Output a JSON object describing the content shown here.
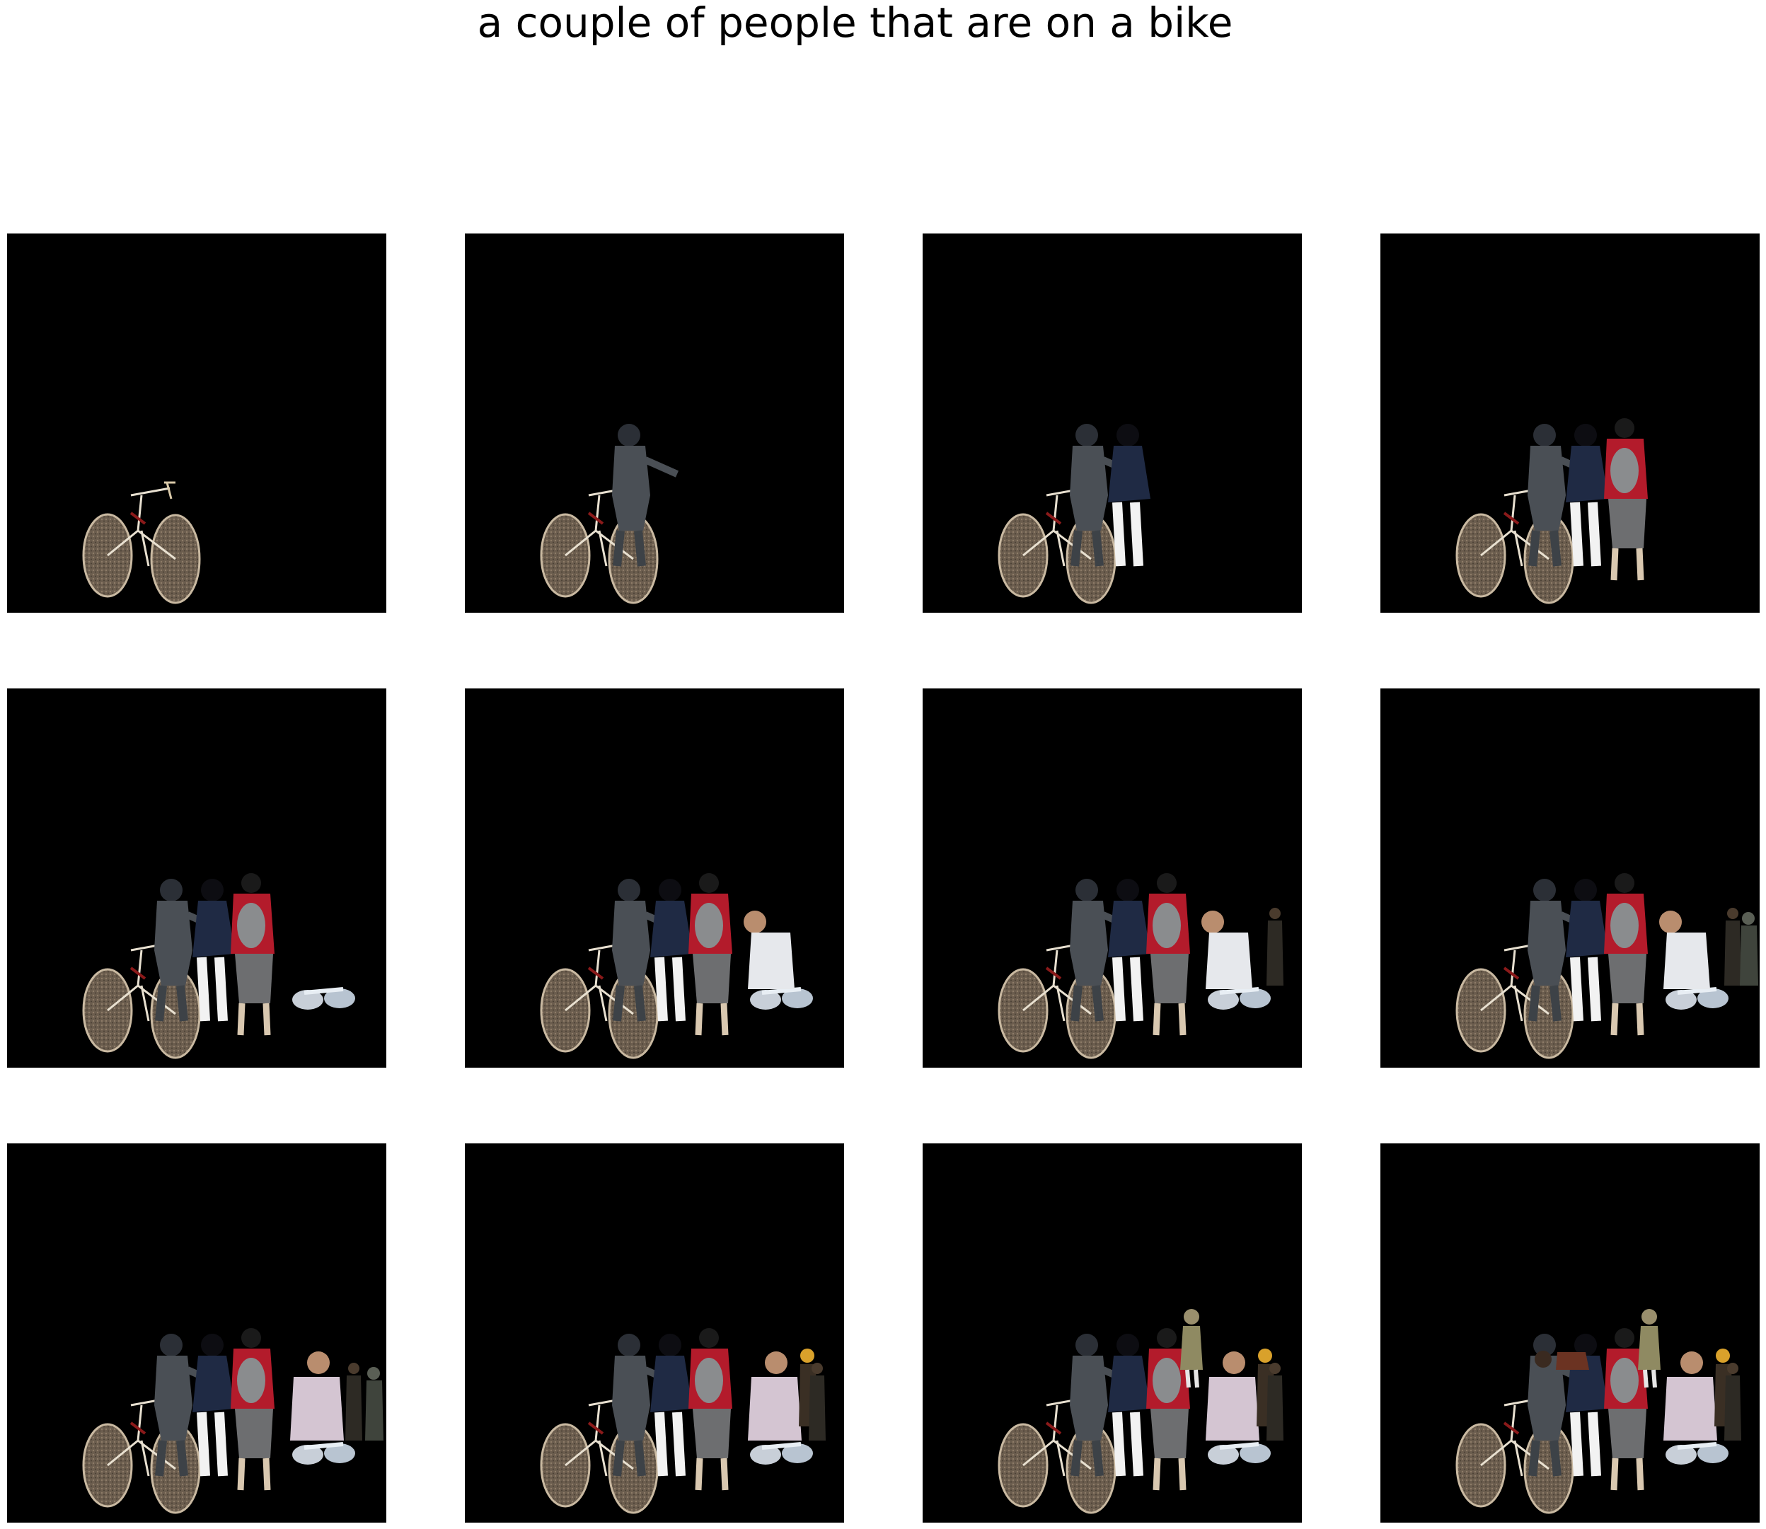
{
  "figure": {
    "title": "a couple of people that are on a bike"
  },
  "panels": [
    {
      "step": 1,
      "objects": [
        "bicycle"
      ]
    },
    {
      "step": 2,
      "objects": [
        "bicycle",
        "cyclist-helmet"
      ]
    },
    {
      "step": 3,
      "objects": [
        "bicycle",
        "cyclist-helmet",
        "person-navy"
      ]
    },
    {
      "step": 4,
      "objects": [
        "bicycle",
        "cyclist-helmet",
        "person-navy",
        "person-red-backpack"
      ]
    },
    {
      "step": 5,
      "objects": [
        "bicycle",
        "cyclist-helmet",
        "person-navy",
        "person-red-backpack",
        "bike-white"
      ]
    },
    {
      "step": 6,
      "objects": [
        "bicycle",
        "cyclist-helmet",
        "person-navy",
        "person-red-backpack",
        "bike-white",
        "man-white-shirt"
      ]
    },
    {
      "step": 7,
      "objects": [
        "bicycle",
        "cyclist-helmet",
        "person-navy",
        "person-red-backpack",
        "bike-white",
        "man-white-shirt",
        "dark-figure"
      ]
    },
    {
      "step": 8,
      "objects": [
        "bicycle",
        "cyclist-helmet",
        "person-navy",
        "person-red-backpack",
        "bike-white",
        "man-white-shirt",
        "dark-figure",
        "dark-figure-2"
      ]
    },
    {
      "step": 9,
      "objects": [
        "bicycle",
        "cyclist-helmet",
        "person-navy",
        "person-red-backpack",
        "bike-white",
        "man-pink-shirt",
        "dark-figures"
      ]
    },
    {
      "step": 10,
      "objects": [
        "bicycle",
        "cyclist-helmet",
        "person-navy",
        "person-red-backpack",
        "bike-white",
        "man-pink-shirt",
        "small-person-yellow",
        "dark-figure"
      ]
    },
    {
      "step": 11,
      "objects": [
        "bicycle",
        "cyclist-helmet",
        "person-navy",
        "person-red-backpack",
        "bike-white",
        "man-pink-shirt",
        "small-person-yellow",
        "small-person-top",
        "dark-figure"
      ]
    },
    {
      "step": 12,
      "objects": [
        "bicycle",
        "cyclist-helmet",
        "person-navy",
        "person-red-backpack",
        "bike-white",
        "man-pink-shirt",
        "small-person-yellow",
        "small-person-top",
        "dark-figure",
        "dark-face"
      ]
    }
  ]
}
